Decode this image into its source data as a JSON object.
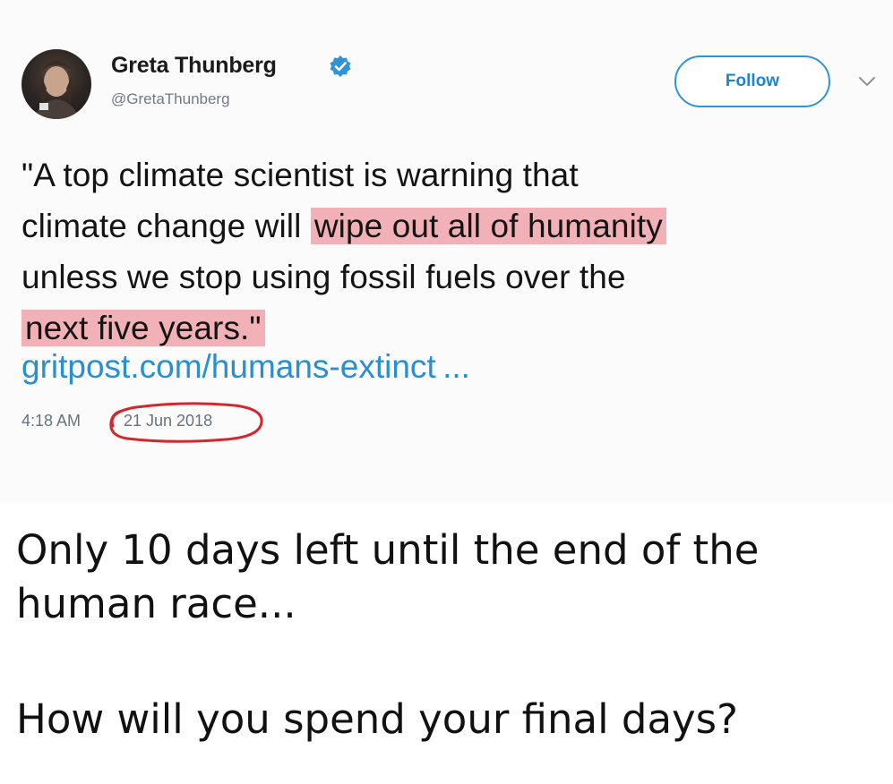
{
  "tweet": {
    "author_name": "Greta Thunberg",
    "author_handle": "@GretaThunberg",
    "follow_label": "Follow",
    "text_lines": [
      {
        "before": "\"A top climate scientist is warning that",
        "highlight": "",
        "after": ""
      },
      {
        "before": "climate change will ",
        "highlight": "wipe out all of humanity",
        "after": ""
      },
      {
        "before": "unless we stop using fossil fuels over the",
        "highlight": "",
        "after": ""
      },
      {
        "before": "",
        "highlight": "next five years.\"",
        "after": ""
      }
    ],
    "link": "gritpost.com/humans-extinct ...",
    "time": "4:18 AM",
    "date": "21 Jun 2018"
  },
  "caption": {
    "line1": "Only 10 days left until the end of the",
    "line2": "human race...",
    "question": "How will you spend your final days?"
  },
  "colors": {
    "highlight": "#f2b1b6",
    "link": "#2a8fd1",
    "follow_border": "#2f93d8",
    "annotation_circle": "#d3272e"
  },
  "icons": {
    "verified": "verified-badge-icon",
    "chevron": "chevron-down-icon"
  }
}
